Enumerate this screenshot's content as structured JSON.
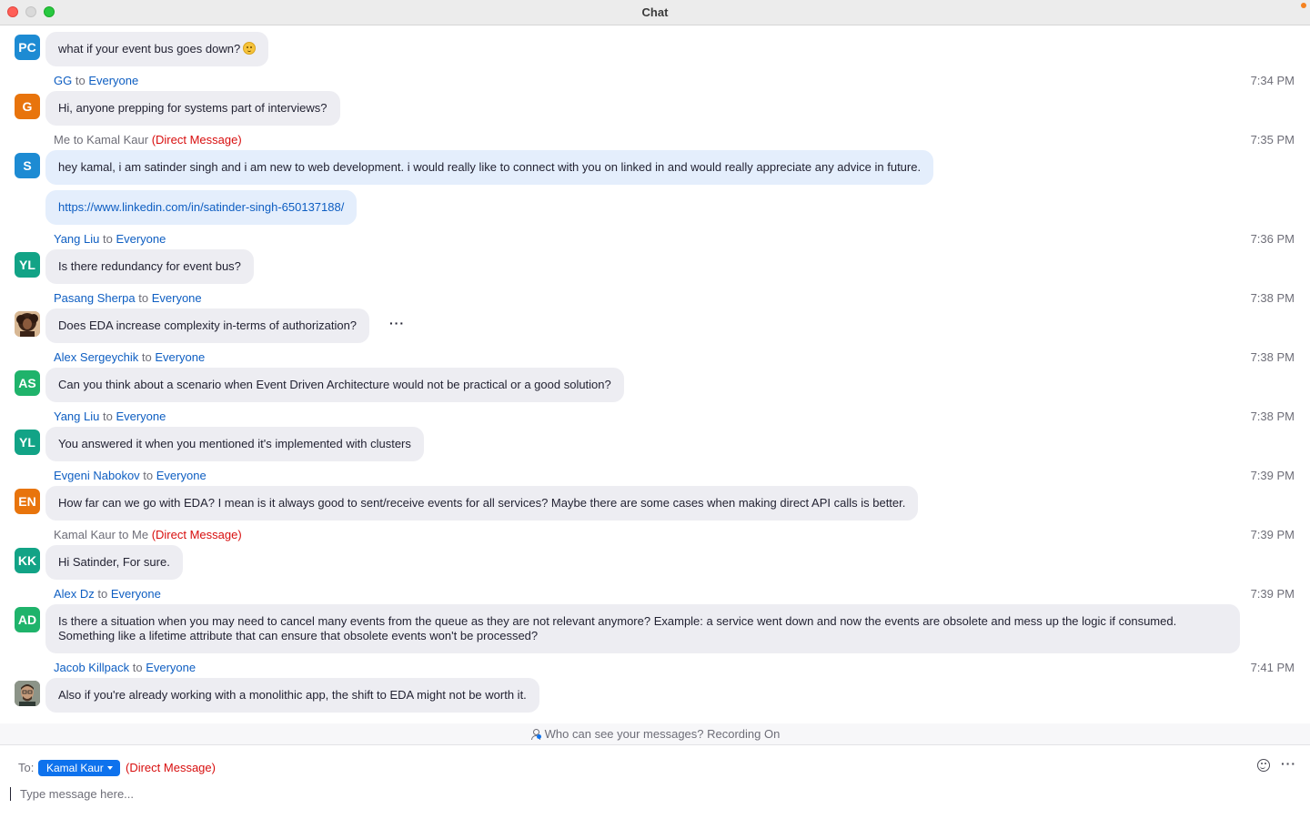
{
  "window": {
    "title": "Chat"
  },
  "messages": [
    {
      "avatar": "PC",
      "avatar_color": "#1d8bd3",
      "sender": "",
      "to": "",
      "target": "",
      "dm": "",
      "time": "",
      "text": "what if your event bus goes down?",
      "emoji": "upside-down-face-emoji"
    },
    {
      "avatar": "G",
      "avatar_color": "#e8740c",
      "sender": "GG",
      "to": "to",
      "target": "Everyone",
      "dm": "",
      "time": "7:34 PM",
      "text": "Hi, anyone prepping for systems part of interviews?"
    },
    {
      "avatar": "S",
      "avatar_color": "#1d8bd3",
      "sender": "Me",
      "to": "to",
      "target": "Kamal Kaur",
      "dm": "(Direct Message)",
      "time": "7:35 PM",
      "text": "hey kamal, i am satinder singh and i am new to web development. i would really like to connect with you on linked in and would really appreciate any advice in future.",
      "link": "https://www.linkedin.com/in/satinder-singh-650137188/"
    },
    {
      "avatar": "YL",
      "avatar_color": "#12a386",
      "sender": "Yang Liu",
      "to": "to",
      "target": "Everyone",
      "dm": "",
      "time": "7:36 PM",
      "text": "Is there redundancy for event bus?"
    },
    {
      "avatar": "",
      "avatar_color": "#5b3a28",
      "sender": "Pasang Sherpa",
      "to": "to",
      "target": "Everyone",
      "dm": "",
      "time": "7:38 PM",
      "text": "Does EDA increase complexity in-terms of authorization?",
      "more": "···"
    },
    {
      "avatar": "AS",
      "avatar_color": "#1fb36b",
      "sender": "Alex Sergeychik",
      "to": "to",
      "target": "Everyone",
      "dm": "",
      "time": "7:38 PM",
      "text": "Can you think about a scenario when Event Driven Architecture would not be practical or a good solution?"
    },
    {
      "avatar": "YL",
      "avatar_color": "#12a386",
      "sender": "Yang Liu",
      "to": "to",
      "target": "Everyone",
      "dm": "",
      "time": "7:38 PM",
      "text": "You answered it when you mentioned it's implemented with clusters"
    },
    {
      "avatar": "EN",
      "avatar_color": "#e8740c",
      "sender": "Evgeni Nabokov",
      "to": "to",
      "target": "Everyone",
      "dm": "",
      "time": "7:39 PM",
      "text": "How far can we go with EDA? I mean is it always good to sent/receive events for all services? Maybe there are some cases when making direct API calls is better."
    },
    {
      "avatar": "KK",
      "avatar_color": "#12a386",
      "sender": "Kamal Kaur",
      "to": "to",
      "target": "Me",
      "dm": "(Direct Message)",
      "time": "7:39 PM",
      "text": "Hi Satinder, For sure."
    },
    {
      "avatar": "AD",
      "avatar_color": "#1fb36b",
      "sender": "Alex Dz",
      "to": "to",
      "target": "Everyone",
      "dm": "",
      "time": "7:39 PM",
      "text": "Is there a situation when you may need to cancel many events from the queue as they are not relevant anymore? Example: a service went down and now the events are obsolete and mess up the logic if consumed. Something like a lifetime attribute that can ensure that obsolete events won't be processed?"
    },
    {
      "avatar": "",
      "avatar_color": "#4d5a52",
      "sender": "Jacob Killpack",
      "to": "to",
      "target": "Everyone",
      "dm": "",
      "time": "7:41 PM",
      "text": "Also if you're already working with a monolithic app, the shift to EDA might not be worth it."
    }
  ],
  "notice": {
    "text": "Who can see your messages? Recording On"
  },
  "compose": {
    "to_label": "To:",
    "recipient": "Kamal Kaur",
    "recipient_dm": "(Direct Message)",
    "placeholder": "Type message here...",
    "more": "···"
  },
  "colors": {
    "accent": "#0e72ed",
    "link": "#0e5ec2",
    "direct_message": "#d80e0e",
    "bubble": "#ededf2",
    "bubble_self": "#e4eefc"
  }
}
